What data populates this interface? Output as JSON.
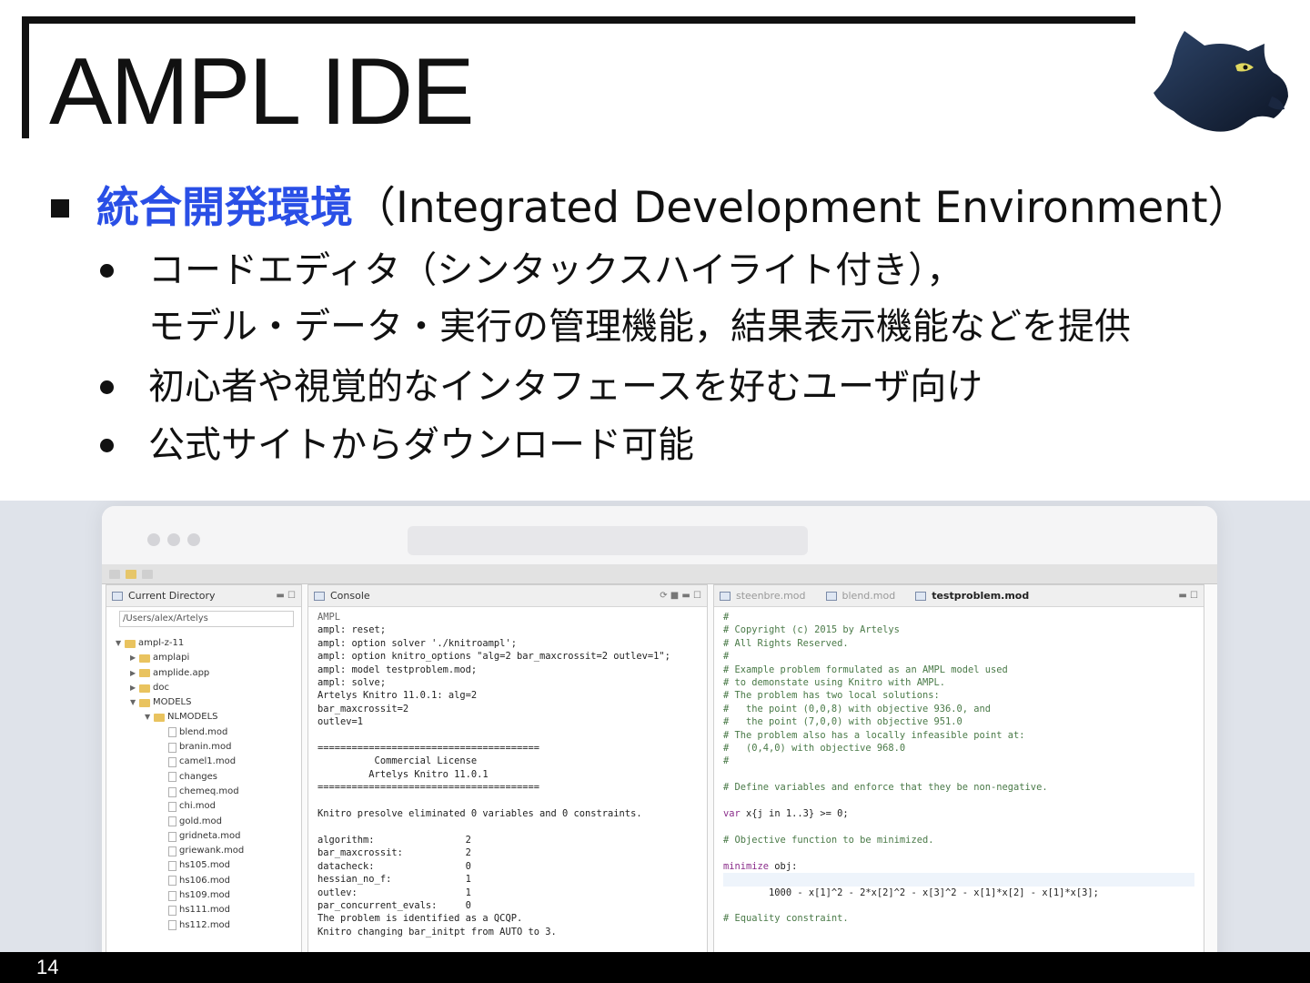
{
  "slide": {
    "title": "AMPL IDE",
    "page_number": "14",
    "colors": {
      "accent": "#2a4fe6",
      "text": "#111111",
      "footer": "#000000"
    }
  },
  "bullets": {
    "main_highlight": "統合開発環境",
    "main_rest": "（Integrated Development Environment）",
    "sub": [
      {
        "lines": [
          "コードエディタ（シンタックスハイライト付き），",
          "モデル・データ・実行の管理機能，結果表示機能などを提供"
        ]
      },
      {
        "lines": [
          "初心者や視覚的なインタフェースを好むユーザ向け"
        ]
      },
      {
        "lines": [
          "公式サイトからダウンロード可能"
        ]
      }
    ]
  },
  "ide": {
    "explorer": {
      "tab_label": "Current Directory",
      "path": "/Users/alex/Artelys",
      "items": [
        {
          "depth": 0,
          "type": "dir",
          "twisty": "▼",
          "name": "ampl-z-11"
        },
        {
          "depth": 1,
          "type": "dir",
          "twisty": "▶",
          "name": "amplapi"
        },
        {
          "depth": 1,
          "type": "dir",
          "twisty": "▶",
          "name": "amplide.app"
        },
        {
          "depth": 1,
          "type": "dir",
          "twisty": "▶",
          "name": "doc"
        },
        {
          "depth": 1,
          "type": "dir",
          "twisty": "▼",
          "name": "MODELS"
        },
        {
          "depth": 2,
          "type": "dir",
          "twisty": "▼",
          "name": "NLMODELS"
        },
        {
          "depth": 3,
          "type": "file",
          "twisty": "",
          "name": "blend.mod"
        },
        {
          "depth": 3,
          "type": "file",
          "twisty": "",
          "name": "branin.mod"
        },
        {
          "depth": 3,
          "type": "file",
          "twisty": "",
          "name": "camel1.mod"
        },
        {
          "depth": 3,
          "type": "file",
          "twisty": "",
          "name": "changes"
        },
        {
          "depth": 3,
          "type": "file",
          "twisty": "",
          "name": "chemeq.mod"
        },
        {
          "depth": 3,
          "type": "file",
          "twisty": "",
          "name": "chi.mod"
        },
        {
          "depth": 3,
          "type": "file",
          "twisty": "",
          "name": "gold.mod"
        },
        {
          "depth": 3,
          "type": "file",
          "twisty": "",
          "name": "gridneta.mod"
        },
        {
          "depth": 3,
          "type": "file",
          "twisty": "",
          "name": "griewank.mod"
        },
        {
          "depth": 3,
          "type": "file",
          "twisty": "",
          "name": "hs105.mod"
        },
        {
          "depth": 3,
          "type": "file",
          "twisty": "",
          "name": "hs106.mod"
        },
        {
          "depth": 3,
          "type": "file",
          "twisty": "",
          "name": "hs109.mod"
        },
        {
          "depth": 3,
          "type": "file",
          "twisty": "",
          "name": "hs111.mod"
        },
        {
          "depth": 3,
          "type": "file",
          "twisty": "",
          "name": "hs112.mod"
        }
      ]
    },
    "console": {
      "tab_label": "Console",
      "header": "AMPL",
      "lines": [
        "ampl: reset;",
        "ampl: option solver './knitroampl';",
        "ampl: option knitro_options \"alg=2 bar_maxcrossit=2 outlev=1\";",
        "ampl: model testproblem.mod;",
        "ampl: solve;",
        "Artelys Knitro 11.0.1: alg=2",
        "bar_maxcrossit=2",
        "outlev=1",
        "",
        "=======================================",
        "          Commercial License",
        "         Artelys Knitro 11.0.1",
        "=======================================",
        "",
        "Knitro presolve eliminated 0 variables and 0 constraints.",
        "",
        "algorithm:                2",
        "bar_maxcrossit:           2",
        "datacheck:                0",
        "hessian_no_f:             1",
        "outlev:                   1",
        "par_concurrent_evals:     0",
        "The problem is identified as a QCQP.",
        "Knitro changing bar_initpt from AUTO to 3."
      ]
    },
    "editor": {
      "tabs": [
        "steenbre.mod",
        "blend.mod",
        "testproblem.mod"
      ],
      "active_tab": "testproblem.mod",
      "lines": [
        {
          "t": "#",
          "c": "cm"
        },
        {
          "t": "# Copyright (c) 2015 by Artelys",
          "c": "cm"
        },
        {
          "t": "# All Rights Reserved.",
          "c": "cm"
        },
        {
          "t": "#",
          "c": "cm"
        },
        {
          "t": "# Example problem formulated as an AMPL model used",
          "c": "cm"
        },
        {
          "t": "# to demonstate using Knitro with AMPL.",
          "c": "cm"
        },
        {
          "t": "# The problem has two local solutions:",
          "c": "cm"
        },
        {
          "t": "#   the point (0,0,8) with objective 936.0, and",
          "c": "cm"
        },
        {
          "t": "#   the point (7,0,0) with objective 951.0",
          "c": "cm"
        },
        {
          "t": "# The problem also has a locally infeasible point at:",
          "c": "cm"
        },
        {
          "t": "#   (0,4,0) with objective 968.0",
          "c": "cm"
        },
        {
          "t": "#",
          "c": "cm"
        },
        {
          "t": "",
          "c": ""
        },
        {
          "t": "# Define variables and enforce that they be non-negative.",
          "c": "cm"
        },
        {
          "t": "",
          "c": ""
        },
        {
          "t": "var x{j in 1..3} >= 0;",
          "c": "kwline"
        },
        {
          "t": "",
          "c": ""
        },
        {
          "t": "# Objective function to be minimized.",
          "c": "cm"
        },
        {
          "t": "",
          "c": ""
        },
        {
          "t": "minimize obj:",
          "c": "kwline"
        },
        {
          "t": "",
          "c": "hl"
        },
        {
          "t": "        1000 - x[1]^2 - 2*x[2]^2 - x[3]^2 - x[1]*x[2] - x[1]*x[3];",
          "c": ""
        },
        {
          "t": "",
          "c": ""
        },
        {
          "t": "# Equality constraint.",
          "c": "cm"
        }
      ]
    }
  }
}
